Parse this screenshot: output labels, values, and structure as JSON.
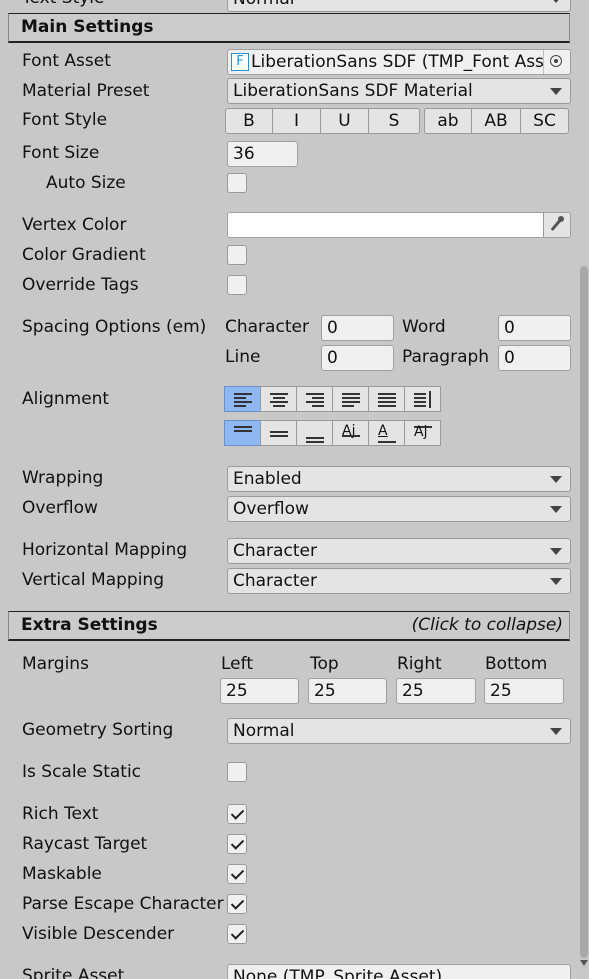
{
  "partial_top": {
    "label": "Text Style",
    "value": "Normal"
  },
  "main_settings": {
    "title": "Main Settings",
    "font_asset": {
      "label": "Font Asset",
      "icon_glyph": "F",
      "value": "LiberationSans SDF (TMP_Font Asset)"
    },
    "material_preset": {
      "label": "Material Preset",
      "value": "LiberationSans SDF Material"
    },
    "font_style": {
      "label": "Font Style",
      "buttons": [
        "B",
        "I",
        "U",
        "S",
        "ab",
        "AB",
        "SC"
      ]
    },
    "font_size": {
      "label": "Font Size",
      "value": "36"
    },
    "auto_size": {
      "label": "Auto Size",
      "checked": false
    },
    "vertex_color": {
      "label": "Vertex Color",
      "color": "#ffffff"
    },
    "color_gradient": {
      "label": "Color Gradient",
      "checked": false
    },
    "override_tags": {
      "label": "Override Tags",
      "checked": false
    },
    "spacing": {
      "label": "Spacing Options (em)",
      "character_label": "Character",
      "character_value": "0",
      "word_label": "Word",
      "word_value": "0",
      "line_label": "Line",
      "line_value": "0",
      "paragraph_label": "Paragraph",
      "paragraph_value": "0"
    },
    "alignment": {
      "label": "Alignment",
      "horizontal": [
        "left",
        "center",
        "right",
        "justified",
        "flush",
        "geometry-center"
      ],
      "horizontal_selected": "left",
      "vertical": [
        "top",
        "middle",
        "bottom",
        "baseline",
        "midline",
        "capline"
      ],
      "vertical_selected": "top"
    },
    "wrapping": {
      "label": "Wrapping",
      "value": "Enabled"
    },
    "overflow": {
      "label": "Overflow",
      "value": "Overflow"
    },
    "horizontal_mapping": {
      "label": "Horizontal Mapping",
      "value": "Character"
    },
    "vertical_mapping": {
      "label": "Vertical Mapping",
      "value": "Character"
    }
  },
  "extra_settings": {
    "title": "Extra Settings",
    "hint": "(Click to collapse)",
    "margins": {
      "label": "Margins",
      "left_label": "Left",
      "left_value": "25",
      "top_label": "Top",
      "top_value": "25",
      "right_label": "Right",
      "right_value": "25",
      "bottom_label": "Bottom",
      "bottom_value": "25"
    },
    "geometry_sorting": {
      "label": "Geometry Sorting",
      "value": "Normal"
    },
    "is_scale_static": {
      "label": "Is Scale Static",
      "checked": false
    },
    "rich_text": {
      "label": "Rich Text",
      "checked": true
    },
    "raycast_target": {
      "label": "Raycast Target",
      "checked": true
    },
    "maskable": {
      "label": "Maskable",
      "checked": true
    },
    "parse_escape": {
      "label": "Parse Escape Characters",
      "checked": true
    },
    "visible_descender": {
      "label": "Visible Descender",
      "checked": true
    },
    "sprite_asset": {
      "label": "Sprite Asset",
      "value": "None (TMP_Sprite Asset)"
    }
  },
  "colors": {
    "panel_bg": "#c8c8c8",
    "field_bg": "#f0f0f0",
    "selected_blue": "#8fb8f2"
  }
}
